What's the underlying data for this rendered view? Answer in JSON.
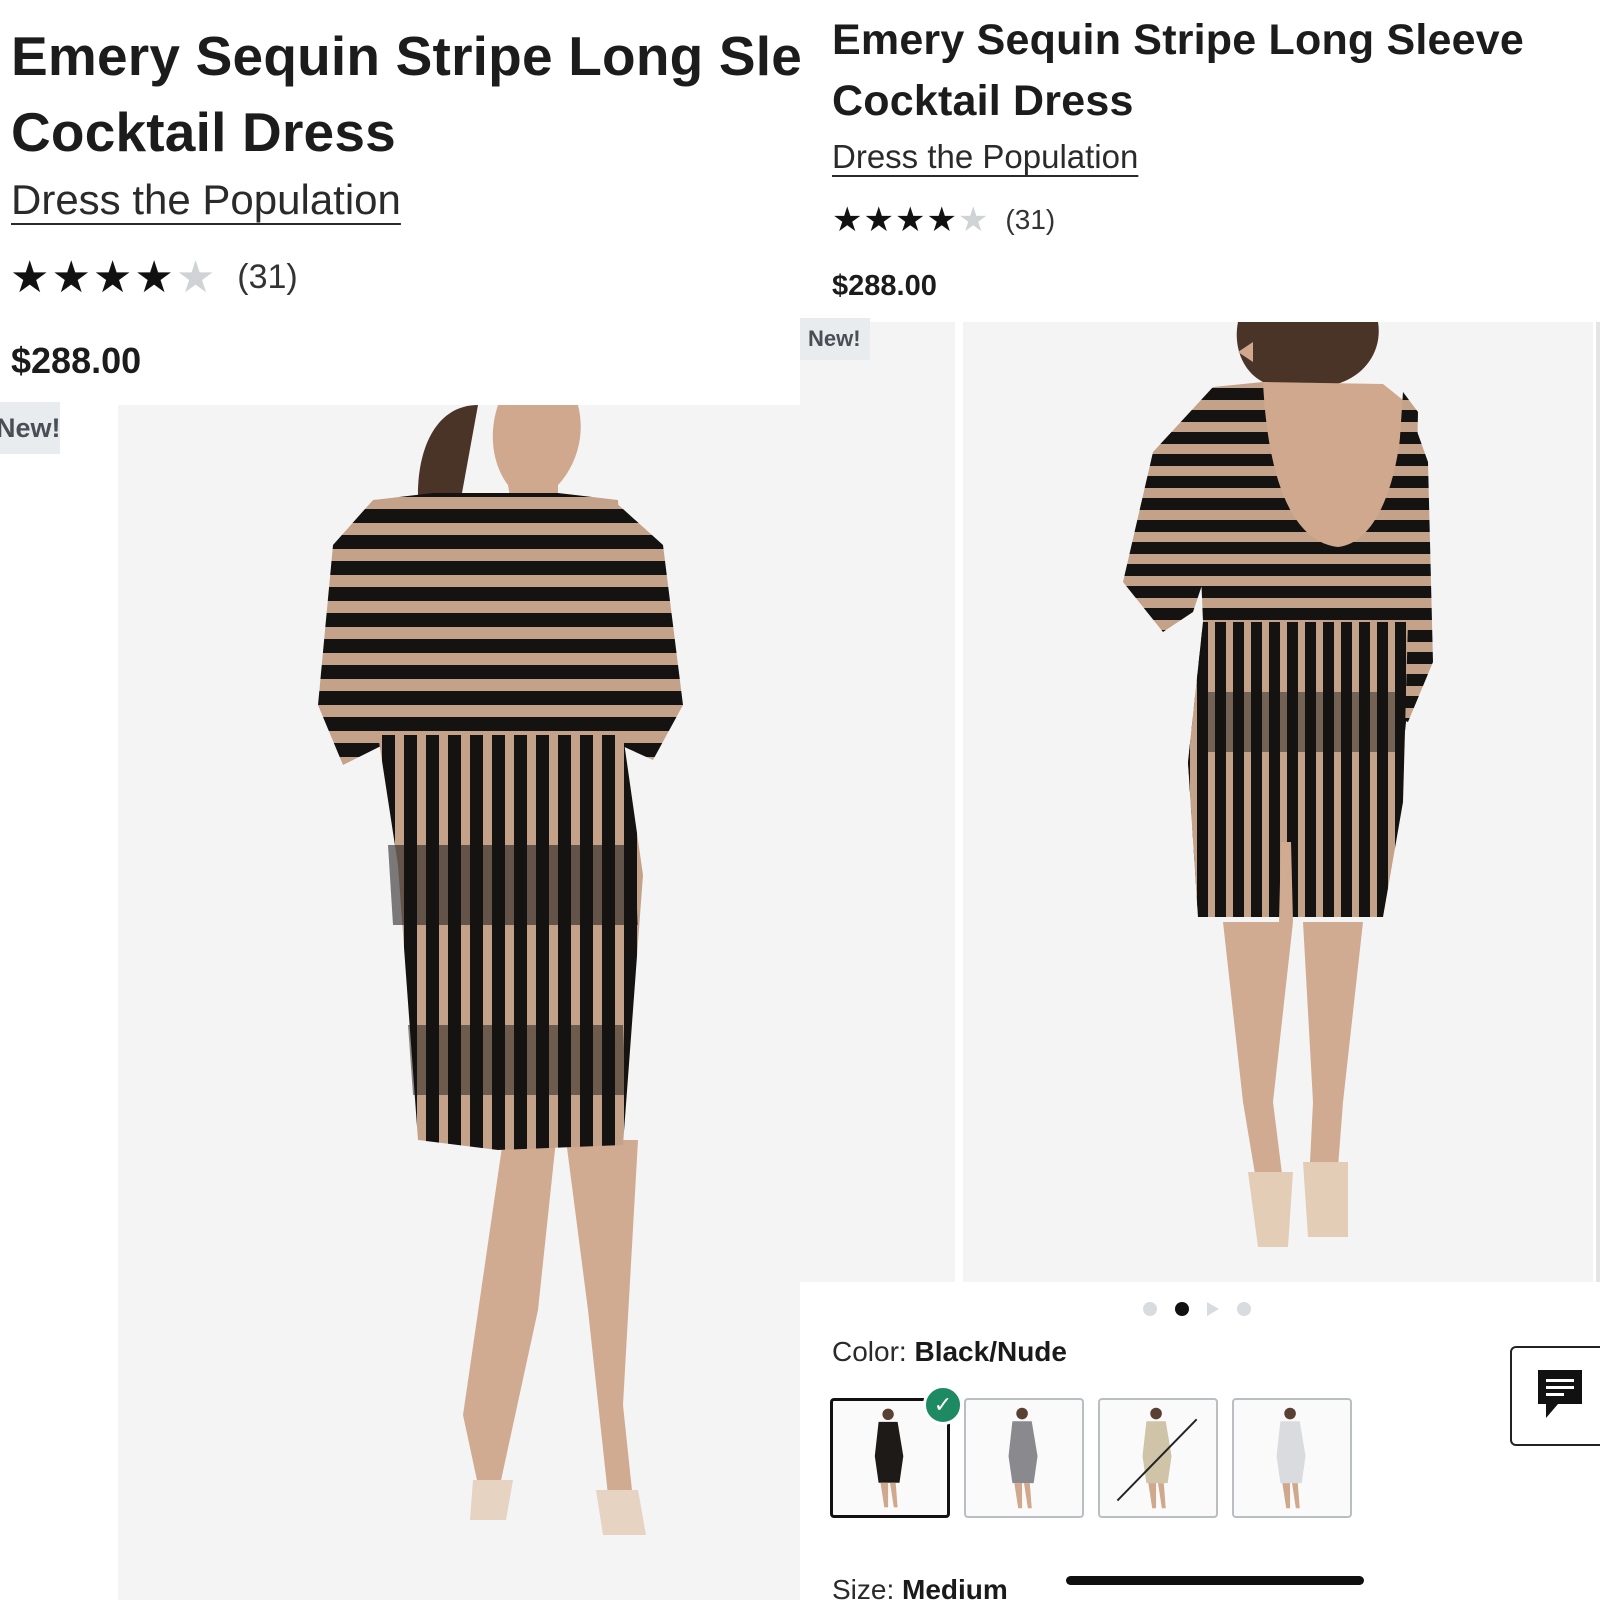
{
  "left": {
    "title": "Emery Sequin Stripe Long Sleeve Cocktail Dress",
    "brand": "Dress the Population",
    "rating": {
      "stars_filled": 4,
      "stars_total": 5,
      "count": "(31)"
    },
    "price": "$288.00",
    "badge": "New!"
  },
  "right": {
    "title": "Emery Sequin Stripe Long Sleeve Cocktail Dress",
    "brand": "Dress the Population",
    "rating": {
      "stars_filled": 4,
      "stars_total": 5,
      "count": "(31)"
    },
    "price": "$288.00",
    "badge": "New!",
    "carousel": {
      "total": 4,
      "active_index": 1
    },
    "color": {
      "label": "Color:",
      "value": "Black/Nude"
    },
    "swatches": [
      {
        "name": "Black/Nude",
        "selected": true,
        "available": true,
        "color": "#1e1a18"
      },
      {
        "name": "Silver",
        "selected": false,
        "available": true,
        "color": "#8a8a8e"
      },
      {
        "name": "Gold",
        "selected": false,
        "available": false,
        "color": "#cfc3a8"
      },
      {
        "name": "White",
        "selected": false,
        "available": true,
        "color": "#e9eaec"
      }
    ],
    "size": {
      "label": "Size:",
      "value": "Medium"
    }
  },
  "icons": {
    "star": "★",
    "check": "✓",
    "chat": "chat-icon"
  },
  "colors": {
    "accent_check": "#1e8a64",
    "star_filled": "#111111",
    "star_empty": "#cfd3d6",
    "dress": "#1a1716",
    "skin": "#caa48a"
  }
}
